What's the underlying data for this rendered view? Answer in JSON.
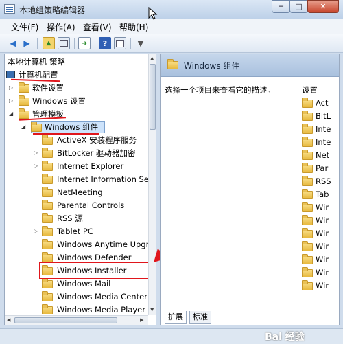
{
  "window": {
    "title": "本地组策略编辑器",
    "min_label": "─",
    "max_label": "□",
    "close_label": "✕"
  },
  "menu": {
    "items": [
      "文件(F)",
      "操作(A)",
      "查看(V)",
      "帮助(H)"
    ]
  },
  "tree": {
    "root": "本地计算机 策略",
    "computer_config": "计算机配置",
    "software_settings": "软件设置",
    "windows_settings": "Windows 设置",
    "admin_templates": "管理模板",
    "windows_components": "Windows 组件",
    "children": [
      "ActiveX 安装程序服务",
      "BitLocker 驱动器加密",
      "Internet Explorer",
      "Internet Information Ser",
      "NetMeeting",
      "Parental Controls",
      "RSS 源",
      "Tablet PC",
      "Windows Anytime Upgr",
      "Windows Defender",
      "Windows Installer",
      "Windows Mail",
      "Windows Media Center",
      "Windows Media Player"
    ]
  },
  "right": {
    "title": "Windows 组件",
    "description": "选择一个项目来查看它的描述。",
    "settings_header": "设置",
    "items": [
      "Act",
      "BitL",
      "Inte",
      "Inte",
      "Net",
      "Par",
      "RSS",
      "Tab",
      "Wir",
      "Wir",
      "Wir",
      "Wir",
      "Wir",
      "Wir",
      "Wir"
    ],
    "tabs": [
      "扩展",
      "标准"
    ]
  },
  "watermark": "Bai 经验"
}
